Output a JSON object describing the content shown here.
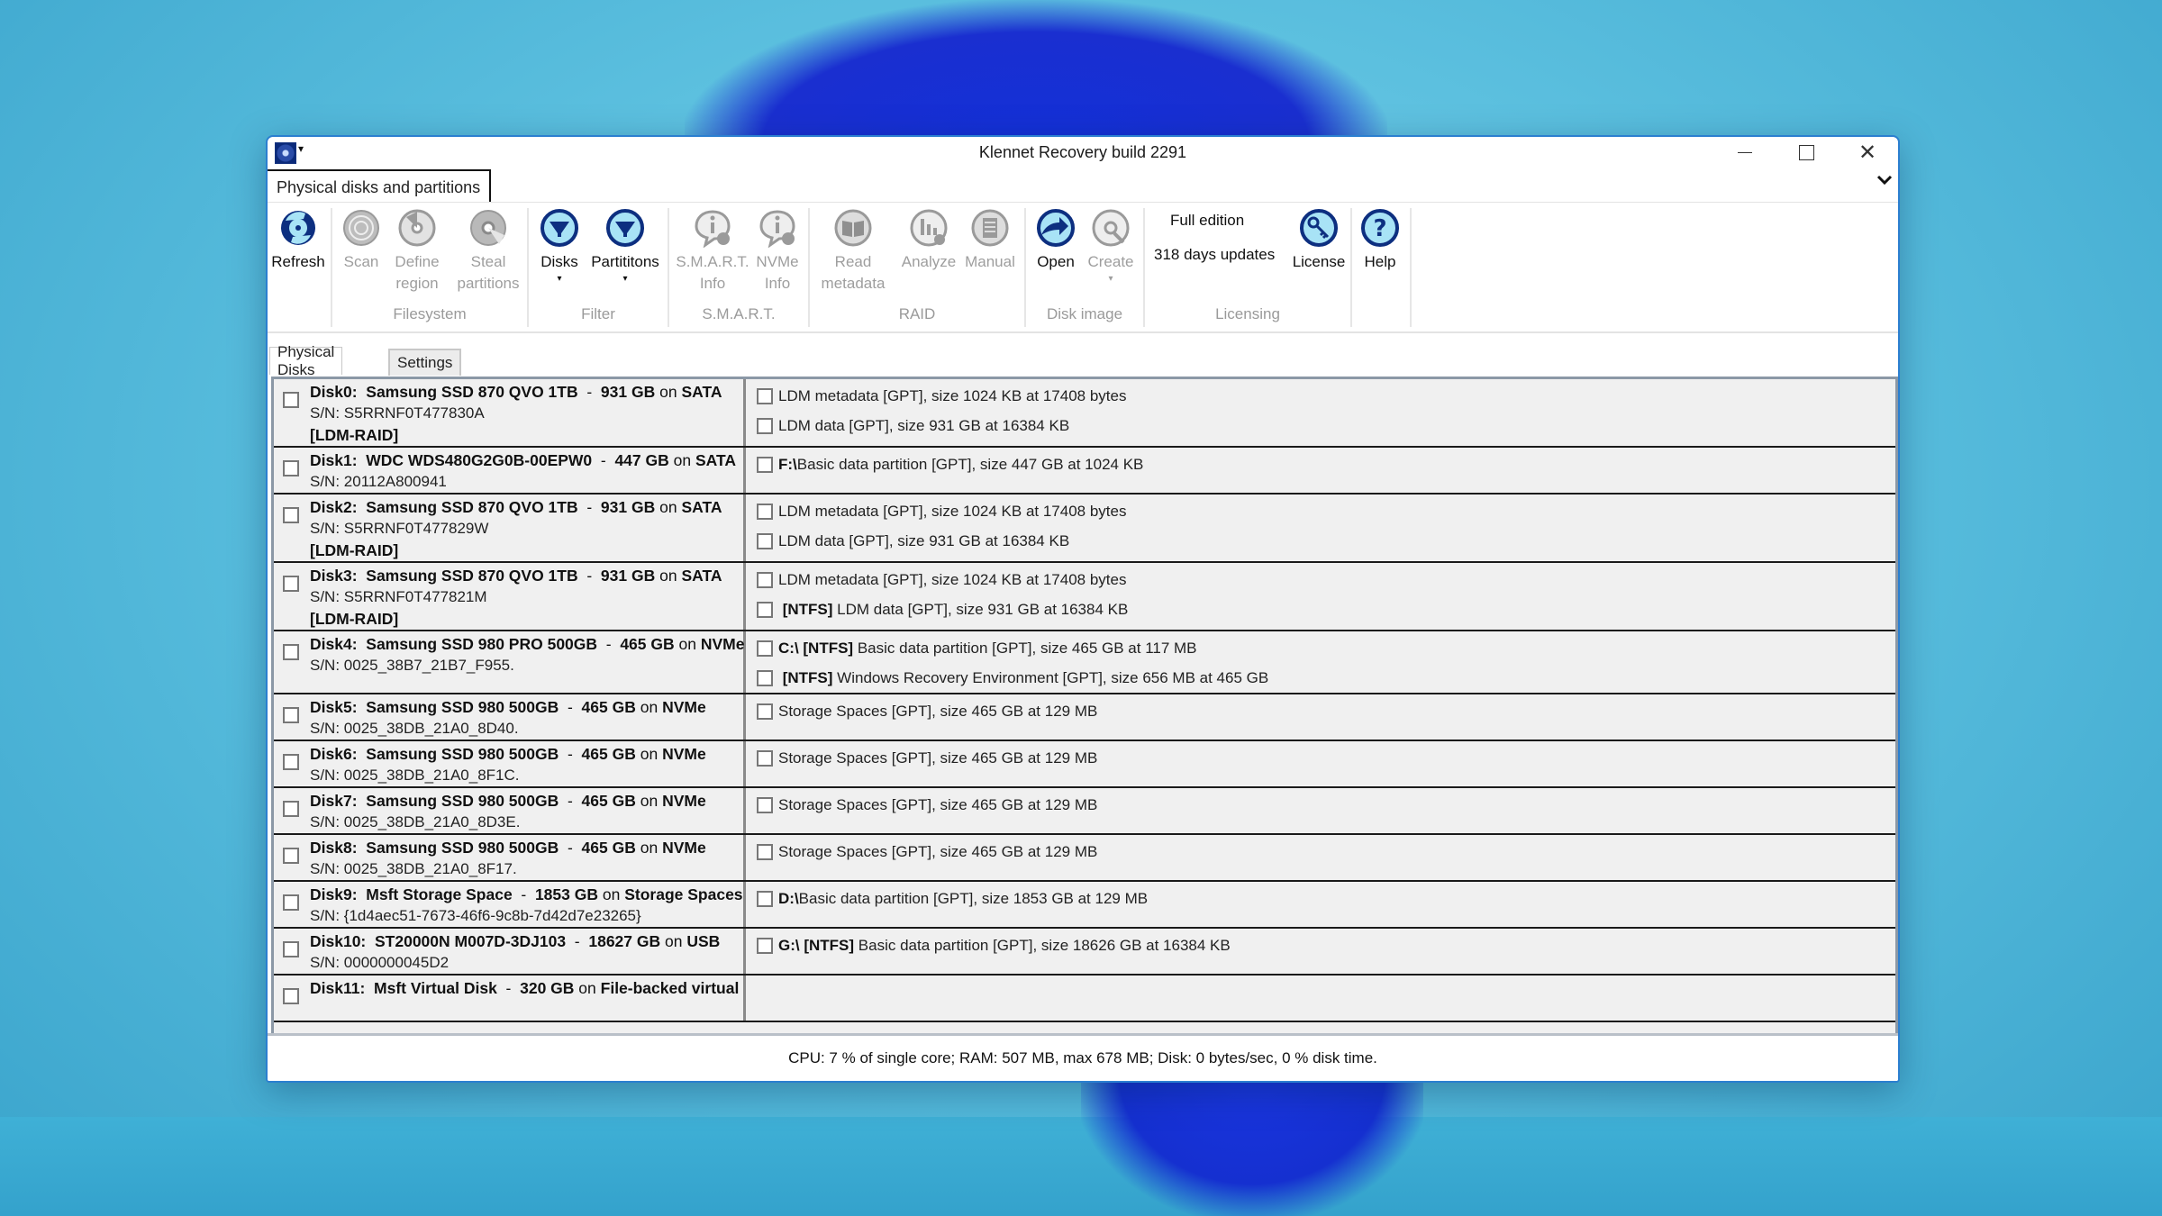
{
  "window": {
    "title": "Klennet Recovery build 2291",
    "app_icon": "disk-recovery-app-icon",
    "quick_access_arrow": "▾",
    "controls": {
      "minimize": "minimize-icon",
      "maximize": "maximize-icon",
      "close": "close-icon",
      "close_glyph": "✕"
    }
  },
  "ribbon": {
    "tab": "Physical disks and partitions",
    "collapse_glyph": "⌄",
    "groups": [
      {
        "label": "",
        "buttons": [
          {
            "label": "Refresh",
            "icon": "refresh-disk-icon",
            "enabled": true
          }
        ]
      },
      {
        "label": "Filesystem",
        "buttons": [
          {
            "label": "Scan",
            "icon": "scan-disk-icon",
            "enabled": false
          },
          {
            "label": "Define region",
            "icon": "define-region-icon",
            "enabled": false
          },
          {
            "label": "Steal partitions",
            "icon": "steal-partitions-icon",
            "enabled": false
          }
        ]
      },
      {
        "label": "Filter",
        "buttons": [
          {
            "label": "Disks",
            "icon": "filter-funnel-icon",
            "enabled": true,
            "dropdown": "▾"
          },
          {
            "label": "Partititons",
            "icon": "filter-funnel-icon",
            "enabled": true,
            "dropdown": "▾"
          }
        ]
      },
      {
        "label": "S.M.A.R.T.",
        "buttons": [
          {
            "label": "S.M.A.R.T. Info",
            "icon": "smart-info-icon",
            "enabled": false
          },
          {
            "label": "NVMe Info",
            "icon": "nvme-info-icon",
            "enabled": false
          }
        ]
      },
      {
        "label": "RAID",
        "buttons": [
          {
            "label": "Read metadata",
            "icon": "read-metadata-book-icon",
            "enabled": false
          },
          {
            "label": "Analyze",
            "icon": "analyze-chart-icon",
            "enabled": false
          },
          {
            "label": "Manual",
            "icon": "manual-list-icon",
            "enabled": false
          }
        ]
      },
      {
        "label": "Disk image",
        "buttons": [
          {
            "label": "Open",
            "icon": "open-image-icon",
            "enabled": true
          },
          {
            "label": "Create",
            "icon": "create-image-icon",
            "enabled": false,
            "dropdown": "▾"
          }
        ]
      },
      {
        "label": "Licensing",
        "edition": "Full edition",
        "updates": "318 days updates",
        "buttons": [
          {
            "label": "License",
            "icon": "license-key-icon",
            "enabled": true
          }
        ]
      },
      {
        "label": "",
        "buttons": [
          {
            "label": "Help",
            "icon": "help-question-icon",
            "enabled": true
          }
        ]
      }
    ]
  },
  "tabs": [
    {
      "label": "Physical Disks",
      "active": true
    },
    {
      "label": "Settings",
      "active": false
    }
  ],
  "disks": [
    {
      "id": "Disk0:",
      "model": "Samsung SSD 870 QVO 1TB",
      "size": "931 GB",
      "on": "on",
      "bus": "SATA",
      "sn": "S/N:  S5RRNF0T477830A",
      "tag": "[LDM-RAID]",
      "partitions": [
        {
          "prefix": "",
          "text": "LDM metadata [GPT], size 1024 KB at 17408 bytes"
        },
        {
          "prefix": "",
          "text": "LDM data [GPT], size 931 GB at 16384 KB"
        }
      ]
    },
    {
      "id": "Disk1:",
      "model": "WDC WDS480G2G0B-00EPW0",
      "size": "447 GB",
      "on": "on",
      "bus": "SATA",
      "sn": "S/N:  20112A800941",
      "tag": "",
      "partitions": [
        {
          "prefix": "F:\\",
          "text": "Basic data partition [GPT], size 447 GB at 1024 KB"
        }
      ]
    },
    {
      "id": "Disk2:",
      "model": "Samsung SSD 870 QVO 1TB",
      "size": "931 GB",
      "on": "on",
      "bus": "SATA",
      "sn": "S/N:  S5RRNF0T477829W",
      "tag": "[LDM-RAID]",
      "partitions": [
        {
          "prefix": "",
          "text": "LDM metadata [GPT], size 1024 KB at 17408 bytes"
        },
        {
          "prefix": "",
          "text": "LDM data [GPT], size 931 GB at 16384 KB"
        }
      ]
    },
    {
      "id": "Disk3:",
      "model": "Samsung SSD 870 QVO 1TB",
      "size": "931 GB",
      "on": "on",
      "bus": "SATA",
      "sn": "S/N:  S5RRNF0T477821M",
      "tag": "[LDM-RAID]",
      "partitions": [
        {
          "prefix": "",
          "text": "LDM metadata [GPT], size 1024 KB at 17408 bytes"
        },
        {
          "prefix": " [NTFS]",
          "text": " LDM data [GPT], size 931 GB at 16384 KB"
        }
      ]
    },
    {
      "id": "Disk4:",
      "model": "Samsung SSD 980 PRO 500GB",
      "size": "465 GB",
      "on": "on",
      "bus": "NVMe",
      "sn": "S/N:  0025_38B7_21B7_F955.",
      "tag": "",
      "partitions": [
        {
          "prefix": "C:\\ [NTFS]",
          "text": " Basic data partition [GPT], size 465 GB at 117 MB"
        },
        {
          "prefix": " [NTFS]",
          "text": " Windows Recovery Environment [GPT], size 656 MB at 465 GB"
        }
      ]
    },
    {
      "id": "Disk5:",
      "model": "Samsung SSD 980 500GB",
      "size": "465 GB",
      "on": "on",
      "bus": "NVMe",
      "sn": "S/N:  0025_38DB_21A0_8D40.",
      "tag": "",
      "partitions": [
        {
          "prefix": "",
          "text": "Storage Spaces [GPT], size 465 GB at 129 MB"
        }
      ]
    },
    {
      "id": "Disk6:",
      "model": "Samsung SSD 980 500GB",
      "size": "465 GB",
      "on": "on",
      "bus": "NVMe",
      "sn": "S/N:  0025_38DB_21A0_8F1C.",
      "tag": "",
      "partitions": [
        {
          "prefix": "",
          "text": "Storage Spaces [GPT], size 465 GB at 129 MB"
        }
      ]
    },
    {
      "id": "Disk7:",
      "model": "Samsung SSD 980 500GB",
      "size": "465 GB",
      "on": "on",
      "bus": "NVMe",
      "sn": "S/N:  0025_38DB_21A0_8D3E.",
      "tag": "",
      "partitions": [
        {
          "prefix": "",
          "text": "Storage Spaces [GPT], size 465 GB at 129 MB"
        }
      ]
    },
    {
      "id": "Disk8:",
      "model": "Samsung SSD 980 500GB",
      "size": "465 GB",
      "on": "on",
      "bus": "NVMe",
      "sn": "S/N:  0025_38DB_21A0_8F17.",
      "tag": "",
      "partitions": [
        {
          "prefix": "",
          "text": "Storage Spaces [GPT], size 465 GB at 129 MB"
        }
      ]
    },
    {
      "id": "Disk9:",
      "model": "Msft Storage Space",
      "size": "1853 GB",
      "on": "on",
      "bus": "Storage Spaces",
      "sn": "S/N:  {1d4aec51-7673-46f6-9c8b-7d42d7e23265}",
      "tag": "",
      "partitions": [
        {
          "prefix": "D:\\",
          "text": "Basic data partition [GPT], size 1853 GB at 129 MB"
        }
      ]
    },
    {
      "id": "Disk10:",
      "model": "ST20000N M007D-3DJ103",
      "size": "18627 GB",
      "on": "on",
      "bus": "USB",
      "sn": "S/N:  0000000045D2",
      "tag": "",
      "partitions": [
        {
          "prefix": "G:\\ [NTFS]",
          "text": " Basic data partition [GPT], size 18626 GB at 16384 KB"
        }
      ]
    },
    {
      "id": "Disk11:",
      "model": "Msft Virtual Disk",
      "size": "320 GB",
      "on": "on",
      "bus": "File-backed virtual",
      "sn": "",
      "tag": "",
      "partitions": []
    }
  ],
  "status": "CPU: 7 % of single core; RAM: 507 MB, max 678 MB; Disk: 0 bytes/sec, 0 % disk time."
}
